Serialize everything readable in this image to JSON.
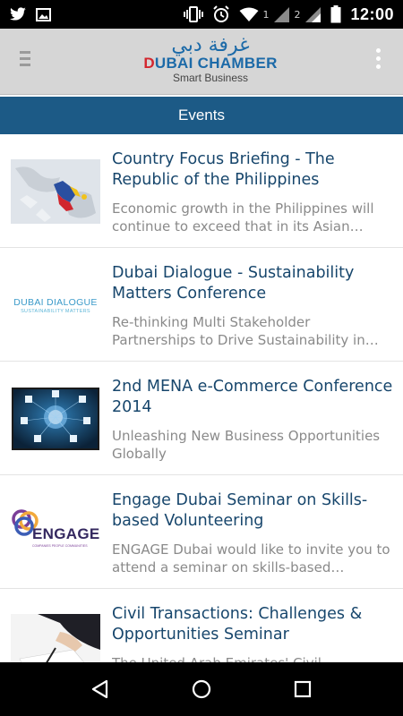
{
  "status_bar": {
    "sim1_label": "1",
    "sim2_label": "2",
    "time": "12:00",
    "icons": [
      "twitter-icon",
      "image-icon",
      "vibrate-icon",
      "alarm-icon",
      "wifi-icon",
      "signal-icon",
      "battery-icon"
    ]
  },
  "header": {
    "logo_arabic": "غرفة دبي",
    "logo_english_first": "D",
    "logo_english_rest": "UBAI CHAMBER",
    "logo_tagline": "Smart Business",
    "brand_color": "#1c6aa8",
    "accent_color": "#d3262e"
  },
  "title_bar": {
    "title": "Events",
    "background": "#1c5a86"
  },
  "events": [
    {
      "title": "Country Focus Briefing - The Republic of the Philippines",
      "description": "Economic growth in the Philippines will continue to exceed that in its Asian…",
      "thumbnail": "philippines-map-image"
    },
    {
      "title": "Dubai Dialogue - Sustainability Matters Conference",
      "description": "Re-thinking Multi Stakeholder Partnerships to Drive Sustainability in…",
      "thumbnail": "dubai-dialogue-logo",
      "thumb_text_1": "DUBAI DIALOGUE",
      "thumb_text_2": "SUSTAINABILITY MATTERS"
    },
    {
      "title": "2nd MENA e-Commerce Conference 2014",
      "description": "Unleashing New Business Opportunities Globally",
      "thumbnail": "ecommerce-network-image"
    },
    {
      "title": "Engage Dubai Seminar on Skills-based Volunteering",
      "description": "ENGAGE Dubai would like to invite you to attend a seminar on skills-based…",
      "thumbnail": "engage-logo",
      "thumb_text_1": "ENGAGE",
      "thumb_text_2": "COMPANIES PEOPLE COMMUNITIES"
    },
    {
      "title": "Civil Transactions: Challenges & Opportunities Seminar",
      "description": "The United Arab Emirates' Civil…",
      "thumbnail": "signing-document-image"
    }
  ]
}
